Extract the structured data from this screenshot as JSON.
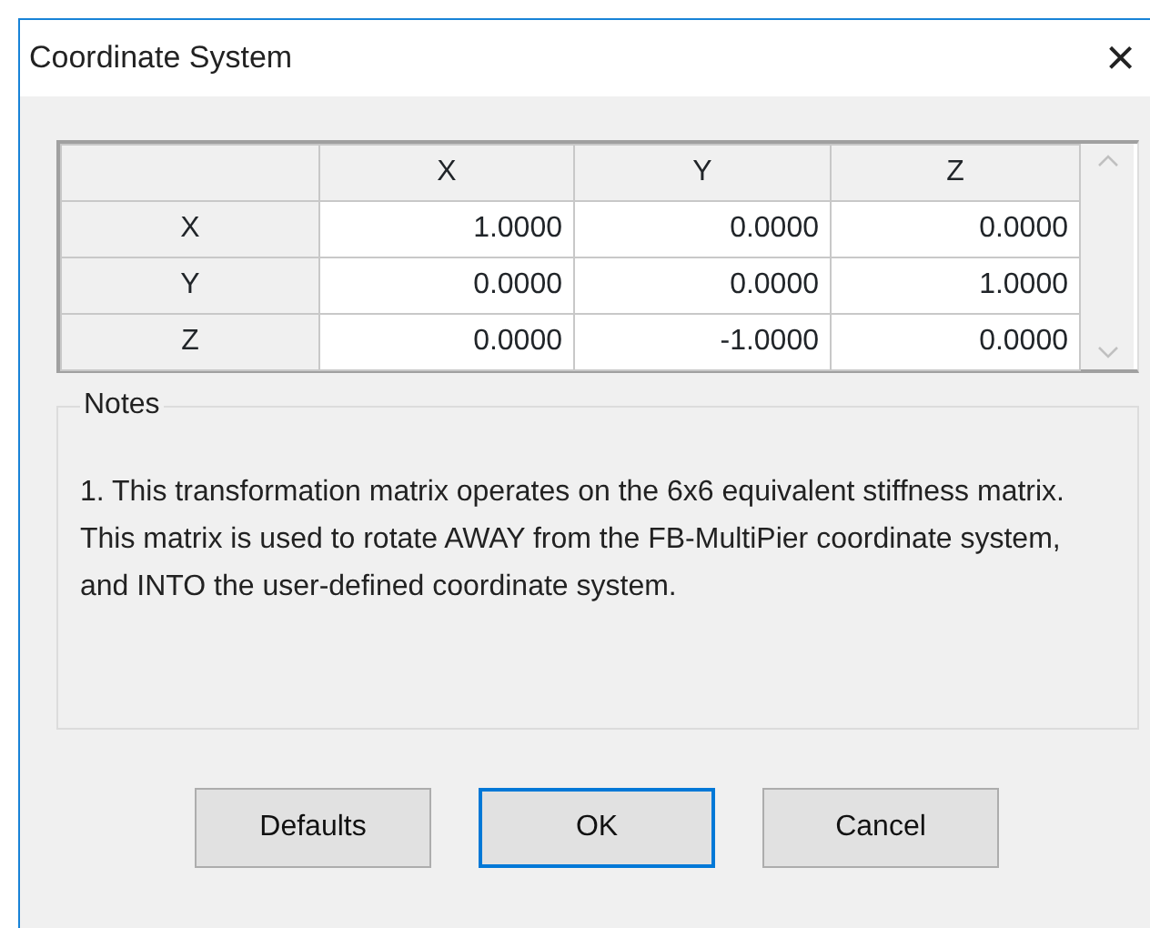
{
  "window": {
    "title": "Coordinate System",
    "close": "×"
  },
  "table": {
    "columns": [
      "X",
      "Y",
      "Z"
    ],
    "rows": [
      {
        "label": "X",
        "cells": [
          "1.0000",
          "0.0000",
          "0.0000"
        ]
      },
      {
        "label": "Y",
        "cells": [
          "0.0000",
          "0.0000",
          "1.0000"
        ]
      },
      {
        "label": "Z",
        "cells": [
          "0.0000",
          "-1.0000",
          "0.0000"
        ]
      }
    ]
  },
  "notes": {
    "title": "Notes",
    "text": "1. This transformation matrix operates on the 6x6 equivalent stiffness matrix. This matrix is used to rotate AWAY from the FB-MultiPier coordinate system, and INTO the user-defined coordinate system."
  },
  "buttons": [
    {
      "label": "Defaults",
      "focused": false
    },
    {
      "label": "OK",
      "focused": true
    },
    {
      "label": "Cancel",
      "focused": false
    }
  ]
}
